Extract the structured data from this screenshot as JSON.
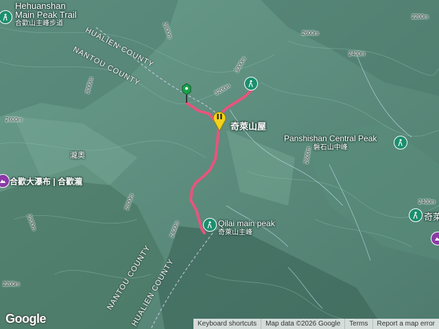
{
  "map": {
    "labels": {
      "hehuan_main_peak_trail_en_1": "Hehuanshan",
      "hehuan_main_peak_trail_en_2": "Main Peak Trail",
      "hehuan_main_peak_trail_zh": "合歡山主峰步道",
      "qilai_hut": "奇萊山屋",
      "panshishan_central_en": "Panshishan Central Peak",
      "panshishan_central_zh": "磐石山中峰",
      "qilai_main_peak_en": "Qilai main peak",
      "qilai_main_peak_zh": "奇萊山主峰",
      "hehuan_waterfall": "合歡大瀑布 | 合歡瀧",
      "long_ao": "瀧奧",
      "right_edge_partial": "奇萊"
    },
    "county_labels": {
      "hualien_top": "HUALIEN COUNTY",
      "nantou_top": "NANTOU COUNTY",
      "nantou_bottom": "NANTOU COUNTY",
      "hualien_bottom": "HUALIEN COUNTY"
    },
    "elevations": [
      "3200m",
      "3000m",
      "2800m",
      "2600m",
      "2400m",
      "2200m",
      "3000m",
      "2600m",
      "2800m",
      "2400m",
      "2200m",
      "2600m",
      "2400m",
      "2200m"
    ],
    "icons": [
      "trailhead-icon",
      "hiking-icon",
      "hut-icon",
      "flag-icon",
      "scenery-icon"
    ],
    "colors": {
      "terrain": "#5f8f80",
      "route": "#e8547e",
      "poi_green": "#1b8f6e",
      "poi_purple": "#8a3aa6",
      "start_flag": "#1aa24a",
      "hut_marker": "#f2d21b"
    }
  },
  "footer": {
    "keyboard_shortcuts": "Keyboard shortcuts",
    "map_data": "Map data ©2026 Google",
    "terms": "Terms",
    "report": "Report a map error",
    "logo": "Google"
  }
}
